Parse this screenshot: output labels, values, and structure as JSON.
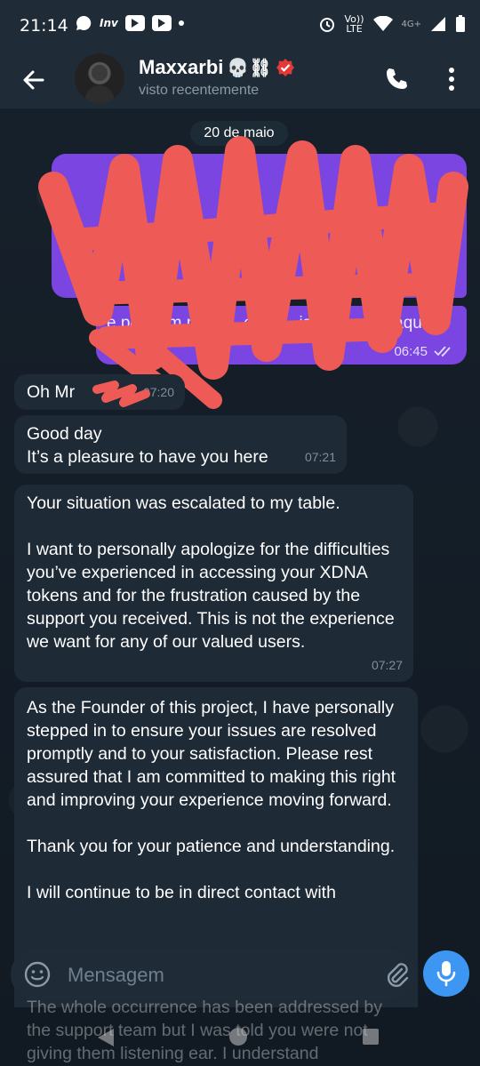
{
  "status_bar": {
    "time": "21:14",
    "app_label": "Inv",
    "network_label_top": "Vo))",
    "network_label_bottom": "LTE",
    "signal_label": "4G+"
  },
  "header": {
    "contact_name": "Maxxarbi",
    "name_emojis": "💀⛓",
    "status": "visto recentemente"
  },
  "chat": {
    "date_separator": "20 de maio",
    "outgoing": [
      {
        "text": "",
        "time": "",
        "read": true
      },
      {
        "text": "e pediram para ... es a ... isso e estou aqui",
        "time": "06:45",
        "read": true
      }
    ],
    "incoming": [
      {
        "text": "Oh Mr",
        "time": "07:20"
      },
      {
        "text": "Good day\nIt’s a pleasure to have you here",
        "time": "07:21"
      },
      {
        "text": "Your situation was escalated to my table.\n\nI want to personally apologize for the difficulties you’ve experienced in accessing your XDNA tokens and for the frustration caused by the support you received. This is not the experience we want for any of our valued users.",
        "time": "07:27"
      },
      {
        "text": "As the Founder of this project, I have personally stepped in to ensure your issues are resolved promptly and to your satisfaction. Please rest assured that I am committed to making this right and improving your experience moving forward.\n\nThank you for your patience and understanding.\n\nI will continue to be in direct contact with",
        "time": ""
      },
      {
        "text": "The whole occurrence has been addressed by the support team but I was told you were not giving them listening ear. I understand",
        "time": ""
      }
    ]
  },
  "composer": {
    "placeholder": "Mensagem"
  },
  "colors": {
    "background": "#0e1621",
    "header": "#1f2c38",
    "outgoing_bubble": "#7a45e0",
    "incoming_bubble": "#1e2a36",
    "accent": "#3d97f2",
    "redaction": "#ee5a55",
    "verified_badge": "#e53935"
  },
  "icons": {
    "back": "arrow-left-icon",
    "call": "phone-icon",
    "menu": "more-vertical-icon",
    "emoji": "smiley-icon",
    "attach": "paperclip-icon",
    "mic": "microphone-icon",
    "verified": "verified-badge-icon"
  }
}
